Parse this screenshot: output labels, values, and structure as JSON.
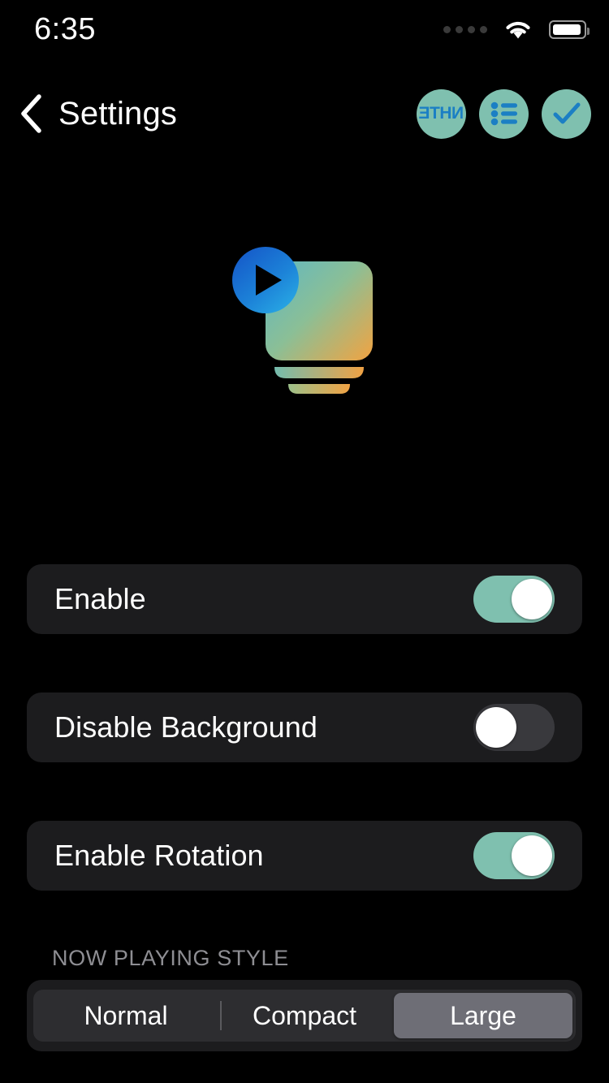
{
  "status_bar": {
    "time": "6:35",
    "signal_icon": "signal-dots-icon",
    "wifi_icon": "wifi-icon",
    "battery_icon": "battery-full-icon",
    "signal_dots": 4
  },
  "nav": {
    "back_icon": "chevron-left-icon",
    "title": "Settings",
    "actions": [
      {
        "name": "nhte-logo-button",
        "label": "NHTE",
        "icon": "nhte-text-icon"
      },
      {
        "name": "list-button",
        "label": "",
        "icon": "list-bullets-icon"
      },
      {
        "name": "done-button",
        "label": "",
        "icon": "checkmark-icon"
      }
    ],
    "accent": "#7fc0af",
    "icon_color": "#1b7fc4"
  },
  "logo": {
    "name": "app-logo",
    "play_icon": "play-circle-icon",
    "gradient_start": "#6fb8b0",
    "gradient_end": "#f0a24a",
    "play_gradient_start": "#1b5fd0",
    "play_gradient_end": "#2aa8e0"
  },
  "settings": {
    "rows": [
      {
        "label": "Enable",
        "value": true,
        "name": "enable"
      },
      {
        "label": "Disable Background",
        "value": false,
        "name": "disable-background"
      },
      {
        "label": "Enable Rotation",
        "value": true,
        "name": "enable-rotation"
      }
    ]
  },
  "now_playing_style": {
    "header": "NOW PLAYING STYLE",
    "options": [
      {
        "label": "Normal",
        "selected": false
      },
      {
        "label": "Compact",
        "selected": false
      },
      {
        "label": "Large",
        "selected": true
      }
    ],
    "selected_value": "Large"
  },
  "colors": {
    "background": "#000000",
    "row_background": "#1c1c1e",
    "toggle_on": "#7fc0af",
    "toggle_off": "#39393d",
    "segment_track": "#2d2d30",
    "segment_selected": "#6e6e76",
    "section_header_text": "#8e8e93"
  }
}
